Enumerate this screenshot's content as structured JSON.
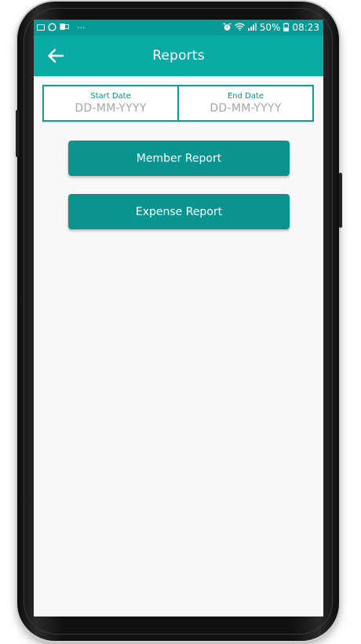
{
  "status_bar": {
    "battery_percent": "50%",
    "time": "08:23",
    "overflow": "···"
  },
  "app_bar": {
    "title": "Reports"
  },
  "date_range": {
    "start_label": "Start Date",
    "start_placeholder": "DD-MM-YYYY",
    "end_label": "End Date",
    "end_placeholder": "DD-MM-YYYY"
  },
  "actions": {
    "member_report": "Member Report",
    "expense_report": "Expense Report"
  },
  "colors": {
    "status_bar": "#079b97",
    "app_bar": "#0aaaa5",
    "button": "#0a9490",
    "border": "#0a9e99"
  },
  "icons": {
    "back": "arrow-left-icon",
    "alarm": "alarm-icon",
    "wifi": "wifi-icon",
    "signal": "signal-icon",
    "battery": "battery-icon"
  }
}
